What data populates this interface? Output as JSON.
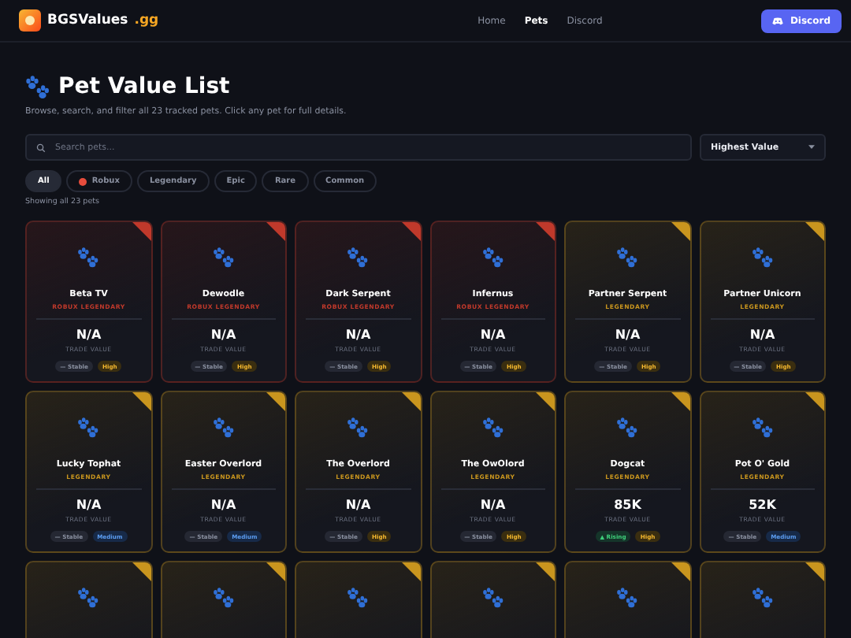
{
  "brand": {
    "name": "BGSValues",
    "suffix": ".gg"
  },
  "nav": [
    {
      "label": "Home",
      "selected": false
    },
    {
      "label": "Pets",
      "selected": true
    },
    {
      "label": "Discord",
      "selected": false
    }
  ],
  "discord_button": "Discord",
  "page": {
    "title": "Pet Value List",
    "subtitle": "Browse, search, and filter all 23 tracked pets. Click any pet for full details."
  },
  "search": {
    "placeholder": "Search pets..."
  },
  "sort": {
    "value": "Highest Value"
  },
  "filters": [
    {
      "label": "All",
      "selected": true,
      "dot": false
    },
    {
      "label": "Robux",
      "selected": false,
      "dot": true
    },
    {
      "label": "Legendary",
      "selected": false,
      "dot": false
    },
    {
      "label": "Epic",
      "selected": false,
      "dot": false
    },
    {
      "label": "Rare",
      "selected": false,
      "dot": false
    },
    {
      "label": "Common",
      "selected": false,
      "dot": false
    }
  ],
  "count": "Showing all 23 pets",
  "pets": [
    {
      "kind": "full",
      "color": "#c0392b",
      "name": "Beta TV",
      "tier": "ROBUX LEGENDARY",
      "value": "N/A",
      "value_label": "TRADE VALUE",
      "trend": {
        "kind": "stable",
        "text": "— Stable"
      },
      "demand": {
        "kind": "high",
        "text": "High"
      }
    },
    {
      "kind": "full",
      "color": "#c0392b",
      "name": "Dewodle",
      "tier": "ROBUX LEGENDARY",
      "value": "N/A",
      "value_label": "TRADE VALUE",
      "trend": {
        "kind": "stable",
        "text": "— Stable"
      },
      "demand": {
        "kind": "high",
        "text": "High"
      }
    },
    {
      "kind": "full",
      "color": "#c0392b",
      "name": "Dark Serpent",
      "tier": "ROBUX LEGENDARY",
      "value": "N/A",
      "value_label": "TRADE VALUE",
      "trend": {
        "kind": "stable",
        "text": "— Stable"
      },
      "demand": {
        "kind": "high",
        "text": "High"
      }
    },
    {
      "kind": "full",
      "color": "#c0392b",
      "name": "Infernus",
      "tier": "ROBUX LEGENDARY",
      "value": "N/A",
      "value_label": "TRADE VALUE",
      "trend": {
        "kind": "stable",
        "text": "— Stable"
      },
      "demand": {
        "kind": "high",
        "text": "High"
      }
    },
    {
      "kind": "full",
      "color": "#c9951e",
      "name": "Partner Serpent",
      "tier": "LEGENDARY",
      "value": "N/A",
      "value_label": "TRADE VALUE",
      "trend": {
        "kind": "stable",
        "text": "— Stable"
      },
      "demand": {
        "kind": "high",
        "text": "High"
      }
    },
    {
      "kind": "full",
      "color": "#c9951e",
      "name": "Partner Unicorn",
      "tier": "LEGENDARY",
      "value": "N/A",
      "value_label": "TRADE VALUE",
      "trend": {
        "kind": "stable",
        "text": "— Stable"
      },
      "demand": {
        "kind": "high",
        "text": "High"
      }
    },
    {
      "kind": "full",
      "color": "#c9951e",
      "name": "Lucky Tophat",
      "tier": "LEGENDARY",
      "value": "N/A",
      "value_label": "TRADE VALUE",
      "trend": {
        "kind": "stable",
        "text": "— Stable"
      },
      "demand": {
        "kind": "medium",
        "text": "Medium"
      }
    },
    {
      "kind": "full",
      "color": "#c9951e",
      "name": "Easter Overlord",
      "tier": "LEGENDARY",
      "value": "N/A",
      "value_label": "TRADE VALUE",
      "trend": {
        "kind": "stable",
        "text": "— Stable"
      },
      "demand": {
        "kind": "medium",
        "text": "Medium"
      }
    },
    {
      "kind": "full",
      "color": "#c9951e",
      "name": "The Overlord",
      "tier": "LEGENDARY",
      "value": "N/A",
      "value_label": "TRADE VALUE",
      "trend": {
        "kind": "stable",
        "text": "— Stable"
      },
      "demand": {
        "kind": "high",
        "text": "High"
      }
    },
    {
      "kind": "full",
      "color": "#c9951e",
      "name": "The OwOlord",
      "tier": "LEGENDARY",
      "value": "N/A",
      "value_label": "TRADE VALUE",
      "trend": {
        "kind": "stable",
        "text": "— Stable"
      },
      "demand": {
        "kind": "high",
        "text": "High"
      }
    },
    {
      "kind": "full",
      "color": "#c9951e",
      "name": "Dogcat",
      "tier": "LEGENDARY",
      "value": "85K",
      "value_label": "TRADE VALUE",
      "trend": {
        "kind": "rising",
        "text": "▲ Rising"
      },
      "demand": {
        "kind": "high",
        "text": "High"
      }
    },
    {
      "kind": "full",
      "color": "#c9951e",
      "name": "Pot O' Gold",
      "tier": "LEGENDARY",
      "value": "52K",
      "value_label": "TRADE VALUE",
      "trend": {
        "kind": "stable",
        "text": "— Stable"
      },
      "demand": {
        "kind": "medium",
        "text": "Medium"
      }
    },
    {
      "kind": "cut",
      "color": "#c9951e"
    },
    {
      "kind": "cut",
      "color": "#c9951e"
    },
    {
      "kind": "cut",
      "color": "#c9951e"
    },
    {
      "kind": "cut",
      "color": "#c9951e"
    },
    {
      "kind": "cut",
      "color": "#c9951e"
    },
    {
      "kind": "cut",
      "color": "#c9951e"
    }
  ]
}
